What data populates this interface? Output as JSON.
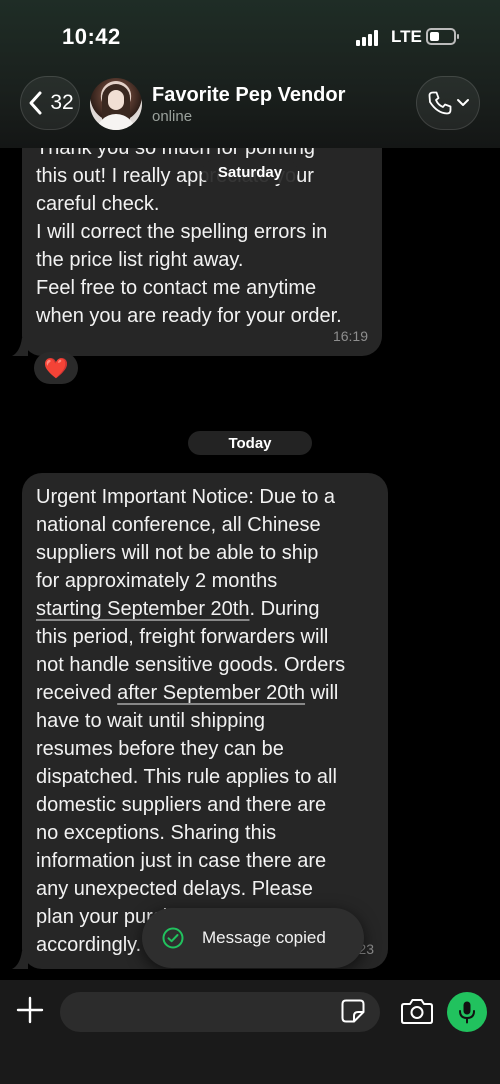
{
  "status_bar": {
    "time": "10:42",
    "network": "LTE"
  },
  "header": {
    "back_count": "32",
    "contact_name": "Favorite Pep Vendor",
    "contact_status": "online"
  },
  "messages": {
    "first": {
      "lines": [
        "Thank you so much for pointing",
        "this out! I really appreciate your",
        "careful check.",
        "I will correct the spelling errors in",
        "the price list right away.",
        "Feel free to contact me anytime",
        "when you are ready for your order."
      ],
      "time": "16:19",
      "reaction": "❤️"
    },
    "date_saturday": "Saturday",
    "date_today": "Today",
    "second": {
      "lines": [
        [
          "Urgent Important Notice: Due to a"
        ],
        [
          "national conference, all Chinese"
        ],
        [
          "suppliers will not be able to ship"
        ],
        [
          "for approximately 2 months"
        ],
        [
          "starting September 20th",
          ". During"
        ],
        [
          "this period, freight forwarders will"
        ],
        [
          "not handle sensitive goods. Orders"
        ],
        [
          "received ",
          "after September 20th",
          " will"
        ],
        [
          "have to wait until shipping"
        ],
        [
          "resumes before they can be"
        ],
        [
          "dispatched. This rule applies to all"
        ],
        [
          "domestic suppliers and there are"
        ],
        [
          "no exceptions. Sharing this"
        ],
        [
          "information just in case there are"
        ],
        [
          "any unexpected delays. Please"
        ],
        [
          "plan your purchases ahead"
        ],
        [
          "accordingly."
        ]
      ],
      "time": "23"
    }
  },
  "toast": {
    "text": "Message copied"
  },
  "input": {
    "placeholder": ""
  },
  "colors": {
    "accent_green": "#21c25e",
    "bubble_bg": "#262626",
    "heart": "#e0242d"
  }
}
